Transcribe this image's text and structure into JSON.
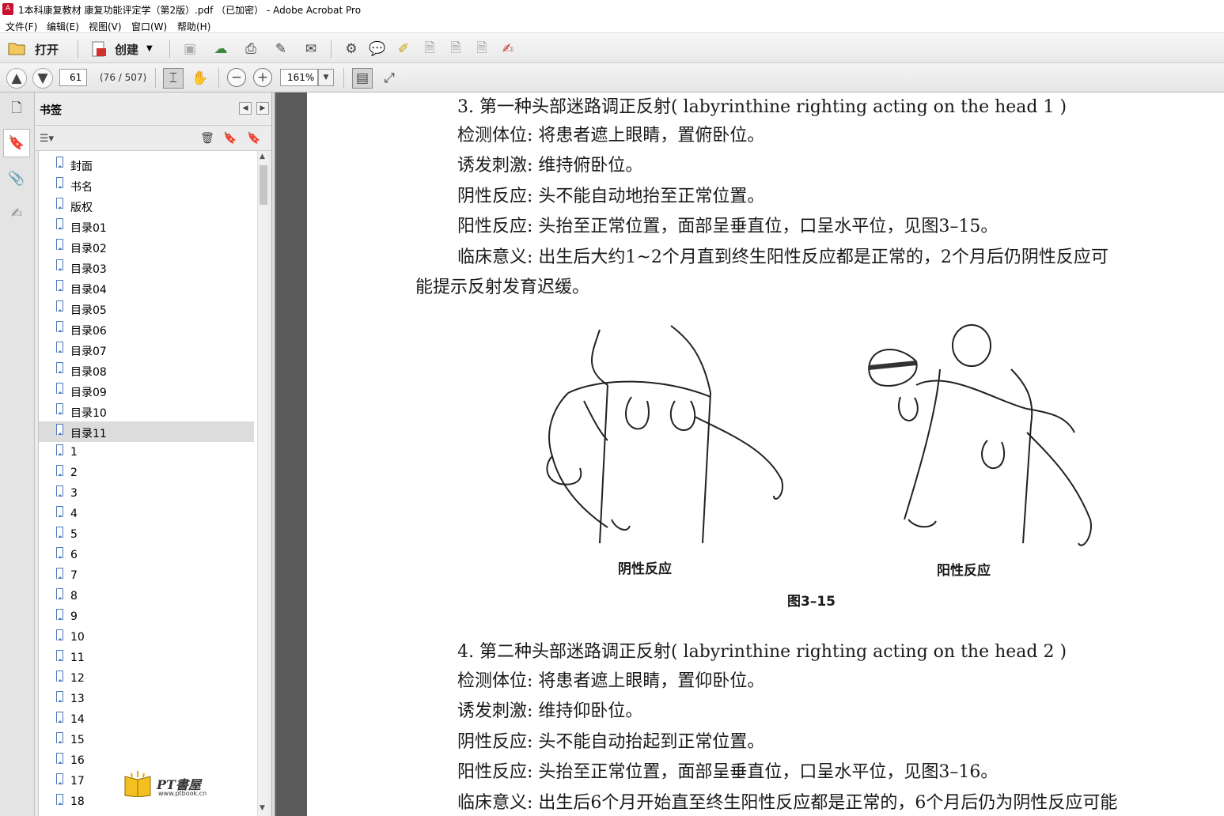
{
  "window": {
    "title": "1本科康复教材 康复功能评定学（第2版）.pdf （已加密） - Adobe Acrobat Pro"
  },
  "menu": [
    "文件(F)",
    "编辑(E)",
    "视图(V)",
    "窗口(W)",
    "帮助(H)"
  ],
  "toolbar": {
    "open_label": "打开",
    "create_label": "创建"
  },
  "nav": {
    "page_input": "61",
    "page_count": "(76 / 507)",
    "zoom": "161%"
  },
  "panel": {
    "title": "书签"
  },
  "bookmarks": [
    "封面",
    "书名",
    "版权",
    "目录01",
    "目录02",
    "目录03",
    "目录04",
    "目录05",
    "目录06",
    "目录07",
    "目录08",
    "目录09",
    "目录10",
    "目录11",
    "1",
    "2",
    "3",
    "4",
    "5",
    "6",
    "7",
    "8",
    "9",
    "10",
    "11",
    "12",
    "13",
    "14",
    "15",
    "16",
    "17",
    "18"
  ],
  "selected_bookmark": "目录11",
  "watermark": {
    "brand": "PT書屋",
    "url": "www.ptbook.cn"
  },
  "document": {
    "lines": [
      "3. 第一种头部迷路调正反射( labyrinthine righting acting on the head 1 )",
      "检测体位: 将患者遮上眼睛，置俯卧位。",
      "诱发刺激: 维持俯卧位。",
      "阴性反应: 头不能自动地抬至正常位置。",
      "阳性反应: 头抬至正常位置，面部呈垂直位，口呈水平位，见图3–15。",
      "临床意义: 出生后大约1~2个月直到终生阳性反应都是正常的，2个月后仍阴性反应可",
      "能提示反射发育迟缓。",
      "4. 第二种头部迷路调正反射( labyrinthine righting acting on the head 2 )",
      "检测体位: 将患者遮上眼睛，置仰卧位。",
      "诱发刺激: 维持仰卧位。",
      "阴性反应: 头不能自动抬起到正常位置。",
      "阳性反应: 头抬至正常位置，面部呈垂直位，口呈水平位，见图3–16。",
      "临床意义: 出生后6个月开始直至终生阳性反应都是正常的，6个月后仍为阴性反应可能"
    ],
    "figure_caption_left": "阴性反应",
    "figure_caption_right": "阳性反应",
    "figure_label": "图3–15"
  }
}
